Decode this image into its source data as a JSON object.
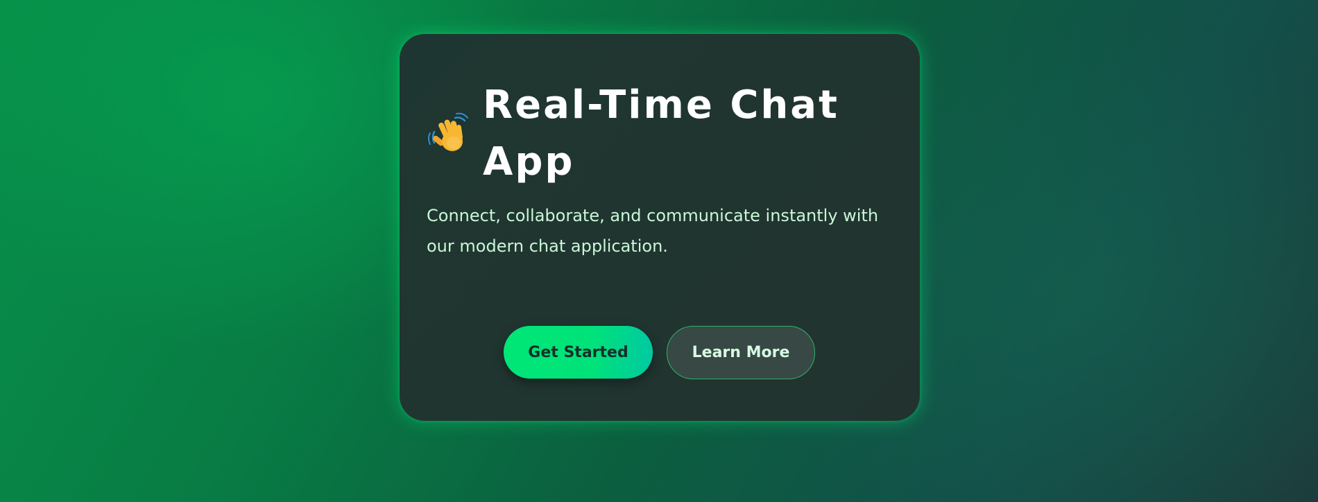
{
  "hero": {
    "icon": "waving-hand-icon",
    "title": "Real-Time Chat App",
    "subtitle": "Connect, collaborate, and communicate instantly with our modern chat application."
  },
  "actions": {
    "primary_label": "Get Started",
    "secondary_label": "Learn More"
  },
  "colors": {
    "accent": "#00e676",
    "card_background": "#213530",
    "subtitle_text": "#c9f7d9"
  }
}
